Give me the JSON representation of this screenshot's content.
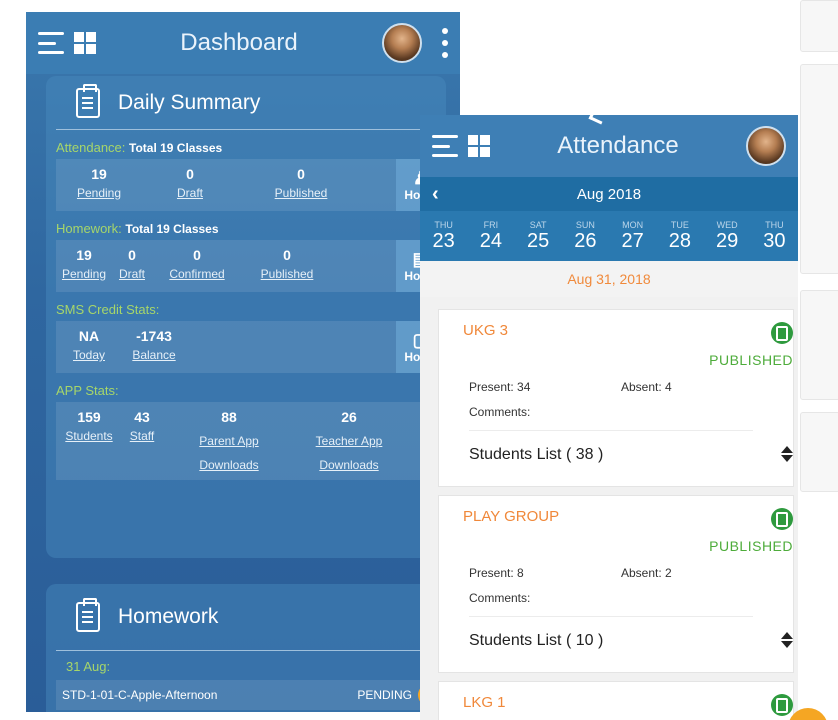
{
  "dashboard": {
    "title": "Dashboard",
    "daily_summary": {
      "title": "Daily Summary",
      "attendance": {
        "label": "Attendance:",
        "total": "Total 19 Classes",
        "stats": [
          {
            "num": "19",
            "label": "Pending"
          },
          {
            "num": "0",
            "label": "Draft"
          },
          {
            "num": "0",
            "label": "Published"
          }
        ],
        "home": "Home"
      },
      "homework": {
        "label": "Homework:",
        "total": "Total 19 Classes",
        "stats": [
          {
            "num": "19",
            "label": "Pending"
          },
          {
            "num": "0",
            "label": "Draft"
          },
          {
            "num": "0",
            "label": "Confirmed"
          },
          {
            "num": "0",
            "label": "Published"
          }
        ],
        "home": "Home"
      },
      "sms": {
        "label": "SMS Credit Stats:",
        "stats": [
          {
            "num": "NA",
            "label": "Today"
          },
          {
            "num": "-1743",
            "label": "Balance"
          }
        ],
        "home": "Home"
      },
      "app": {
        "label": "APP Stats:",
        "stats": [
          {
            "num": "159",
            "label": "Students"
          },
          {
            "num": "43",
            "label": "Staff"
          },
          {
            "num": "88",
            "label": "Parent App Downloads"
          },
          {
            "num": "26",
            "label": "Teacher App Downloads"
          }
        ]
      }
    },
    "homework_card": {
      "title": "Homework",
      "date": "31 Aug:",
      "row": {
        "name": "STD-1-01-C-Apple-Afternoon",
        "status": "PENDING"
      }
    }
  },
  "attendance": {
    "title": "Attendance",
    "month": "Aug 2018",
    "days": [
      {
        "name": "THU",
        "date": "23"
      },
      {
        "name": "FRI",
        "date": "24"
      },
      {
        "name": "SAT",
        "date": "25"
      },
      {
        "name": "SUN",
        "date": "26"
      },
      {
        "name": "MON",
        "date": "27"
      },
      {
        "name": "TUE",
        "date": "28"
      },
      {
        "name": "WED",
        "date": "29"
      },
      {
        "name": "THU",
        "date": "30"
      }
    ],
    "selected_date": "Aug 31, 2018",
    "cards": [
      {
        "class": "UKG 3",
        "status": "PUBLISHED",
        "present": "Present: 34",
        "absent": "Absent: 4",
        "comments": "Comments:",
        "students": "Students List ( 38 )"
      },
      {
        "class": "PLAY GROUP",
        "status": "PUBLISHED",
        "present": "Present: 8",
        "absent": "Absent: 2",
        "comments": "Comments:",
        "students": "Students List ( 10 )"
      },
      {
        "class": "LKG 1"
      }
    ]
  },
  "colors": {
    "header_blue": "#3b7db3",
    "accent_green": "#a6d66a",
    "class_orange": "#f0883a",
    "published_green": "#4eac3b"
  }
}
